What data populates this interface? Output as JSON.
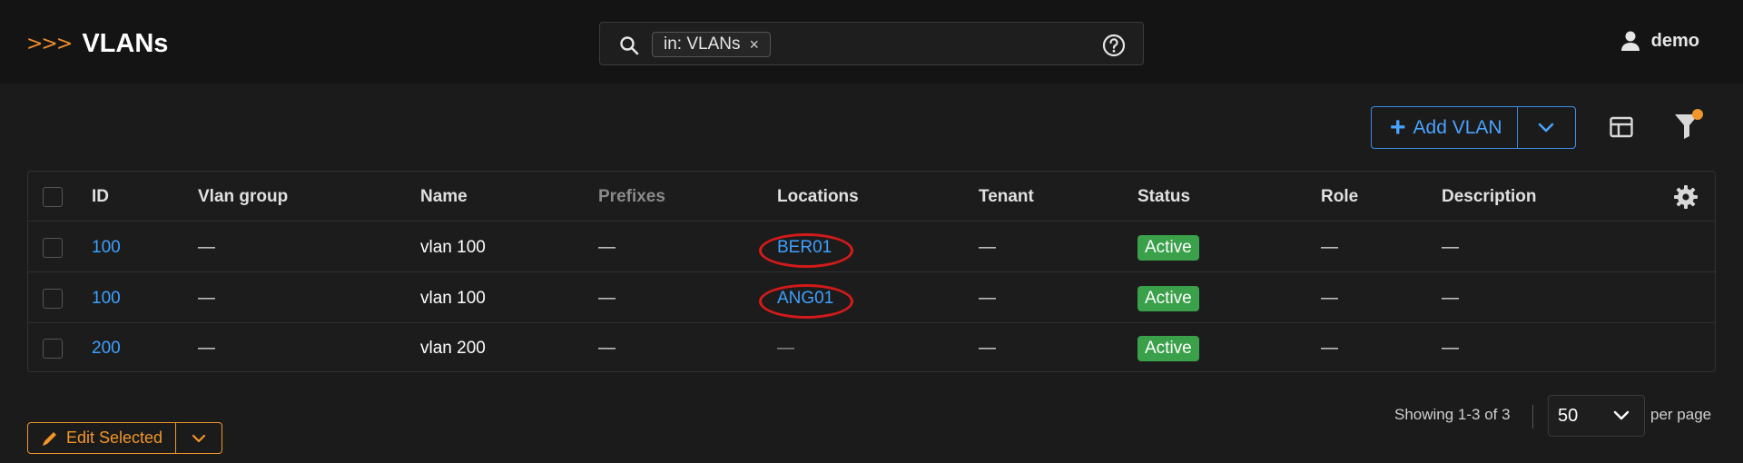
{
  "header": {
    "brand_mark": ">>>",
    "title": "VLANs",
    "search": {
      "chip_label": "in: VLANs",
      "chip_close": "×"
    },
    "user": "demo"
  },
  "toolbar": {
    "add_label": "Add VLAN",
    "add_plus": "+"
  },
  "table": {
    "columns": [
      "ID",
      "Vlan group",
      "Name",
      "Prefixes",
      "Locations",
      "Tenant",
      "Status",
      "Role",
      "Description"
    ],
    "rows": [
      {
        "id": "100",
        "vlan_group": "—",
        "name": "vlan 100",
        "prefixes": "—",
        "location": "BER01",
        "tenant": "—",
        "status": "Active",
        "role": "—",
        "description": "—"
      },
      {
        "id": "100",
        "vlan_group": "—",
        "name": "vlan 100",
        "prefixes": "—",
        "location": "ANG01",
        "tenant": "—",
        "status": "Active",
        "role": "—",
        "description": "—"
      },
      {
        "id": "200",
        "vlan_group": "—",
        "name": "vlan 200",
        "prefixes": "—",
        "location": "—",
        "tenant": "—",
        "status": "Active",
        "role": "—",
        "description": "—"
      }
    ],
    "highlighted_locations": [
      "BER01",
      "ANG01"
    ]
  },
  "footer": {
    "edit_label": "Edit Selected",
    "showing": "Showing 1-3 of 3",
    "per_page_value": "50",
    "per_page_label": "per page"
  },
  "colors": {
    "accent_orange": "#f0962a",
    "link_blue": "#3ea0ff",
    "status_active": "#3aa04a",
    "highlight_red": "#d41a1a"
  },
  "icons": [
    "search-icon",
    "help-icon",
    "user-icon",
    "plus-icon",
    "chevron-down-icon",
    "layout-icon",
    "filter-icon",
    "gear-icon",
    "pencil-icon"
  ]
}
